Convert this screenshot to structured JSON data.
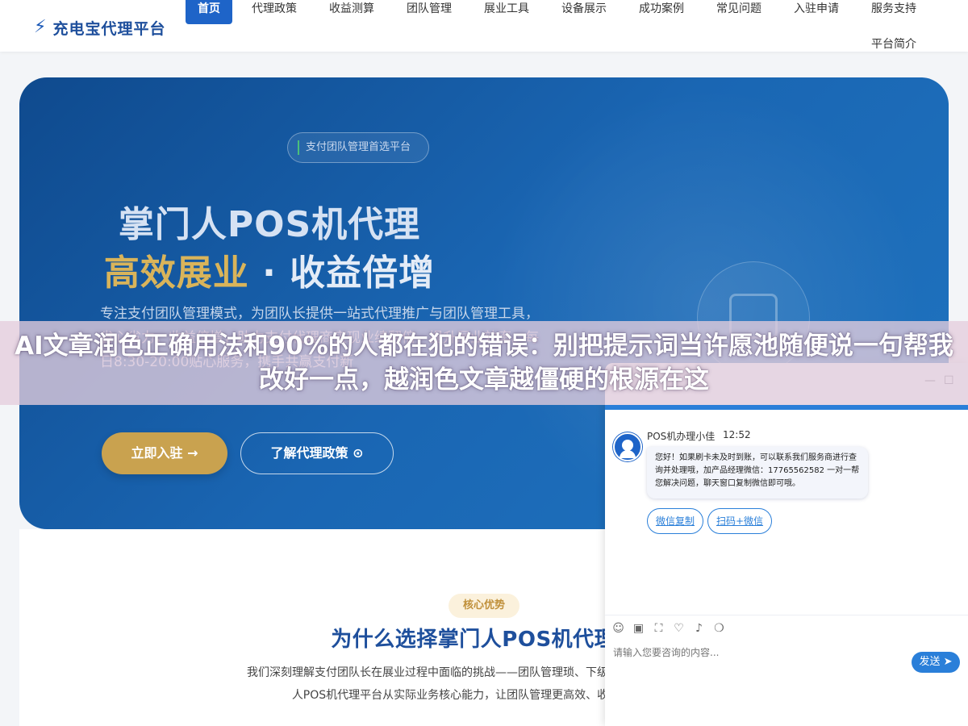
{
  "header": {
    "logo_icon": "⚡",
    "logo_text": "充电宝代理平台",
    "nav": [
      {
        "label": "首页",
        "active": true
      },
      {
        "label": "代理政策"
      },
      {
        "label": "收益测算"
      },
      {
        "label": "团队管理"
      },
      {
        "label": "展业工具"
      },
      {
        "label": "设备展示"
      },
      {
        "label": "成功案例"
      },
      {
        "label": "常见问题"
      },
      {
        "label": "入驻申请"
      },
      {
        "label": "服务支持"
      },
      {
        "label": "平台简介"
      }
    ]
  },
  "hero": {
    "badge": "支付团队管理首选平台",
    "title_line1": "掌门人POS机代理",
    "title_gold": "高效展业",
    "title_rest": " · 收益倍增",
    "description": "专注支付团队管理模式，为团队长提供一站式代理推广与团队管理工具，省心省力，收益倍增，助力支付代理商实现业绩翻倍，提升展业效率。每日8:30-20:00贴心服务，携手共赢支付新",
    "primary_button": "立即入驻 →",
    "secondary_button": "了解代理政策 ⊙"
  },
  "advantages": {
    "tag": "核心优势",
    "title": "为什么选择掌门人POS机代理平",
    "description": "我们深刻理解支付团队长在展业过程中面临的挑战——团队管理琐、下级代理培训成本高。掌门人POS机代理平台从实际业务核心能力，让团队管理更高效、收益增长更稳健"
  },
  "overlay": {
    "text": "AI文章润色正确用法和90%的人都在犯的错误：别把提示词当许愿池随便说一句帮我改好一点，越润色文章越僵硬的根源在这"
  },
  "chat": {
    "minimize": "—",
    "maximize": "☐",
    "agent_name": "POS机办理小佳",
    "time": "12:52",
    "message": "您好！如果刷卡未及时到账，可以联系我们服务商进行查询并处理哦，加产品经理微信：17765562582 一对一帮您解决问题，聊天窗口复制微信即可哦。",
    "quick_buttons": [
      "微信复制",
      "扫码+微信"
    ],
    "toolbar_icons": [
      {
        "name": "emoji-icon",
        "glyph": "☺"
      },
      {
        "name": "image-icon",
        "glyph": "▣"
      },
      {
        "name": "screenshot-icon",
        "glyph": "⛶"
      },
      {
        "name": "evaluate-icon",
        "glyph": "♡"
      },
      {
        "name": "sound-icon",
        "glyph": "♪"
      },
      {
        "name": "chat-record-icon",
        "glyph": "❍"
      }
    ],
    "input_placeholder": "请输入您要咨询的内容...",
    "send_label": "发送 ➤"
  },
  "colors": {
    "brand_blue": "#1e64c8",
    "gold": "#c9a24f",
    "chat_accent": "#2a7fd9"
  }
}
